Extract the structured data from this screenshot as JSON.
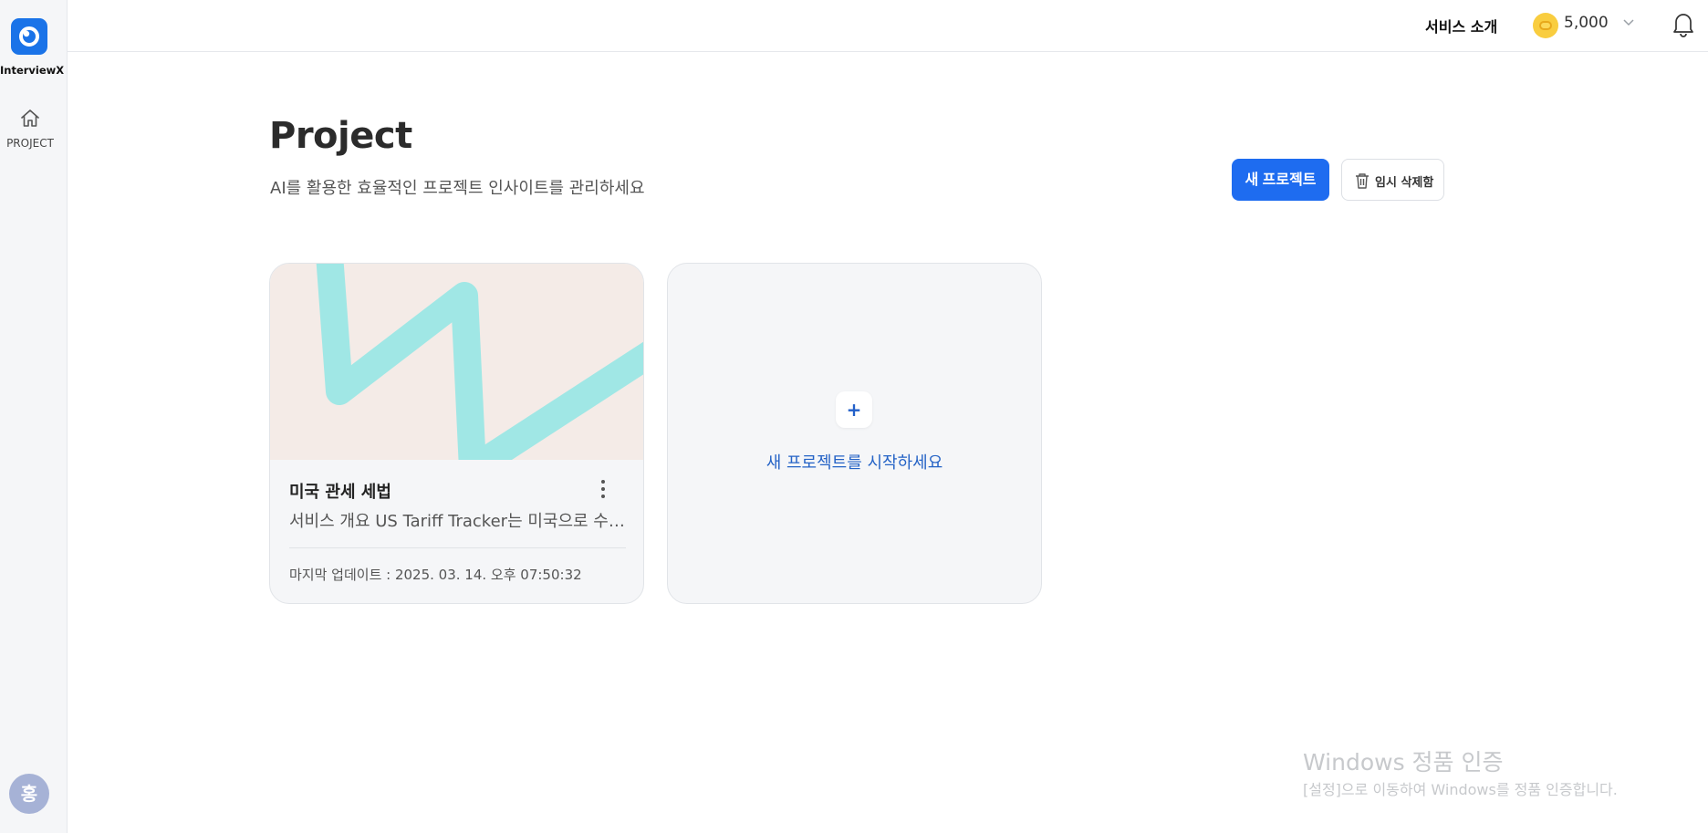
{
  "app": {
    "brand": "InterviewX",
    "accent": "#1e6cf0"
  },
  "sidebar": {
    "items": [
      {
        "label": "PROJECT",
        "icon": "home-icon"
      }
    ],
    "avatar": "홍"
  },
  "topbar": {
    "service_intro": "서비스 소개",
    "credits": "5,000",
    "credit_icon": "coin-icon",
    "notification_icon": "bell-icon"
  },
  "header": {
    "title": "Project",
    "subtitle": "AI를 활용한 효율적인 프로젝트 인사이트를 관리하세요",
    "new_project_label": "새 프로젝트",
    "trash_label": "임시 삭제함"
  },
  "projects": [
    {
      "title": "미국 관세 세법",
      "description": "서비스 개요 US Tariff Tracker는 미국으로 수출하는 기업을 위한 관세 정보 서비스",
      "updated": "마지막 업데이트 : 2025. 03. 14. 오후 07:50:32"
    }
  ],
  "new_project_card": {
    "plus": "+",
    "label": "새 프로젝트를 시작하세요"
  },
  "watermark": {
    "title": "Windows 정품 인증",
    "subtitle": "[설정]으로 이동하여 Windows를 정품 인증합니다."
  }
}
